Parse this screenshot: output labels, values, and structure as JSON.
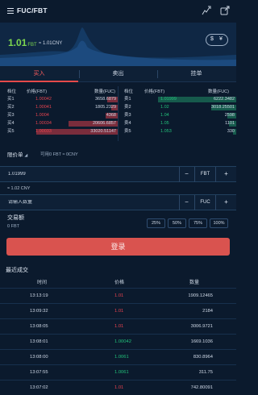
{
  "header": {
    "title": "FUC/FBT",
    "icons": [
      "menu-icon",
      "chart-toggle-icon",
      "share-icon"
    ]
  },
  "hero": {
    "price": "1.01",
    "price_unit": "FBT",
    "approx": "≈ 1.01CNY",
    "fx_left": "$",
    "fx_right": "¥"
  },
  "tabs": [
    {
      "label": "买入",
      "active": true
    },
    {
      "label": "卖出",
      "active": false
    },
    {
      "label": "挂单",
      "active": false
    }
  ],
  "order_book": {
    "headers": {
      "pos": "档位",
      "price": "价格(FBT)",
      "qty": "数量(FUC)"
    },
    "asks": [
      {
        "label": "买1",
        "price": "1.00042",
        "qty": "3658.6879",
        "depth": 0.12
      },
      {
        "label": "买2",
        "price": "1.00041",
        "qty": "1805.2329",
        "depth": 0.07
      },
      {
        "label": "买3",
        "price": "1.0004",
        "qty": "4368",
        "depth": 0.14
      },
      {
        "label": "买4",
        "price": "1.00034",
        "qty": "20606.6857",
        "depth": 0.55
      },
      {
        "label": "买5",
        "price": "1.00033",
        "qty": "33020.51147",
        "depth": 0.92
      }
    ],
    "bids": [
      {
        "label": "卖1",
        "price": "1.01999",
        "qty": "6222.3482",
        "depth": 0.88
      },
      {
        "label": "卖2",
        "price": "1.02",
        "qty": "3018.25501",
        "depth": 0.28
      },
      {
        "label": "卖3",
        "price": "1.04",
        "qty": "2598",
        "depth": 0.1
      },
      {
        "label": "卖4",
        "price": "1.05",
        "qty": "1101",
        "depth": 0.08
      },
      {
        "label": "卖5",
        "price": "1.053",
        "qty": "330",
        "depth": 0.04
      }
    ]
  },
  "order_form": {
    "price_mode": "限价单",
    "available": "可用0 FBT ≈ 0CNY",
    "price_value": "1.01999",
    "price_unit": "FBT",
    "approx_cny": "≈ 1.02 CNY",
    "qty_placeholder": "请输入数量",
    "qty_unit": "FUC",
    "volume_label": "交易额",
    "volume_value": "0 FBT",
    "percent_options": [
      "25%",
      "50%",
      "75%",
      "100%"
    ],
    "submit_label": "登录"
  },
  "recent_trades": {
    "title": "最近成交",
    "headers": {
      "time": "时间",
      "price": "价格",
      "qty": "数量"
    },
    "rows": [
      {
        "time": "13:13:19",
        "price": "1.01",
        "qty": "1909.12465",
        "side": "sell"
      },
      {
        "time": "13:09:32",
        "price": "1.01",
        "qty": "2184",
        "side": "sell"
      },
      {
        "time": "13:08:05",
        "price": "1.01",
        "qty": "3006.9721",
        "side": "sell"
      },
      {
        "time": "13:08:01",
        "price": "1.00042",
        "qty": "1669.1036",
        "side": "buy"
      },
      {
        "time": "13:08:00",
        "price": "1.0061",
        "qty": "830.8964",
        "side": "buy"
      },
      {
        "time": "13:07:55",
        "price": "1.0061",
        "qty": "311.75",
        "side": "buy"
      },
      {
        "time": "13:07:02",
        "price": "1.01",
        "qty": "742.80091",
        "side": "sell"
      }
    ]
  },
  "colors": {
    "background": "#0b1a2d",
    "ask": "#e8434f",
    "bid": "#22c07a",
    "accent": "#d9534f",
    "hero_price": "#7dd84f"
  }
}
